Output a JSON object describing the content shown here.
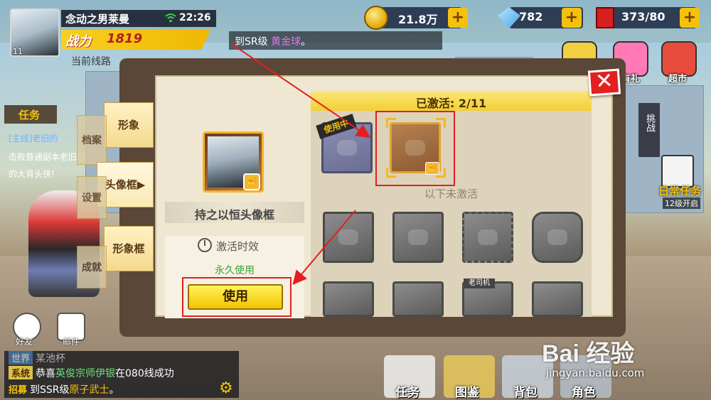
{
  "hud": {
    "player_name": "念动之男莱曼",
    "time": "22:26",
    "avatar_level": "11",
    "power_label": "战力",
    "power_value": "1819",
    "route_label": "当前线路",
    "ticker_prefix": "到SR级",
    "ticker_highlight": "黄金球",
    "ticker_suffix": "。"
  },
  "resources": [
    {
      "icon": "gold-coin-icon",
      "value": "21.8万"
    },
    {
      "icon": "diamond-icon",
      "value": "782"
    },
    {
      "icon": "ticket-icon",
      "value": "373/80"
    }
  ],
  "shortcuts": [
    {
      "icon": "gift-icon",
      "label": "有礼"
    },
    {
      "icon": "shop-icon",
      "label": "超市"
    }
  ],
  "task_panel": {
    "title": "任务",
    "line1": "[主线]老旧的",
    "line2": "击败普通副本老旧的",
    "line3": "的大背头侠!"
  },
  "right_side": {
    "challenge": "挑战",
    "daily_task": "日常任务",
    "daily_unlock": "12级开启"
  },
  "bottom_left": {
    "friends": "好友",
    "mail": "邮件"
  },
  "chat": {
    "line1_tag": "世界",
    "line1_text": "某池杯",
    "line2_tag": "系统",
    "line2_pre": "恭喜",
    "line2_name": "英俊宗师伊银",
    "line2_post": "在080线成功",
    "line3_tag": "招募",
    "line3_pre": "到SSR级",
    "line3_item": "原子武士",
    "line3_post": "。"
  },
  "bottom_nav": [
    {
      "icon": "task-icon",
      "label": "任务"
    },
    {
      "icon": "album-icon",
      "label": "图鉴"
    },
    {
      "icon": "backpack-icon",
      "label": "背包"
    },
    {
      "icon": "character-icon",
      "label": "角色"
    }
  ],
  "modal": {
    "side_tabs": [
      {
        "label": "形象",
        "peek": "档案",
        "active": false
      },
      {
        "label": "头像框▶",
        "peek": "设置",
        "active": true
      },
      {
        "label": "形象框",
        "peek": "成就",
        "active": false
      }
    ],
    "frame_name": "持之以恒头像框",
    "validity_label": "激活时效",
    "validity_value": "永久使用",
    "use_button": "使用",
    "activated_label": "已激活: 2/11",
    "in_use_tag": "使用中",
    "inactive_label": "以下未激活",
    "driver_tag": "老司机",
    "close_icon": "✕"
  },
  "watermark": {
    "logo": "Bai 经验",
    "url": "jingyan.baidu.com"
  },
  "colors": {
    "accent_yellow": "#f4c20d",
    "highlight_red": "#e32020",
    "green_text": "#3aa33a",
    "modal_bg": "#efe7d1"
  }
}
